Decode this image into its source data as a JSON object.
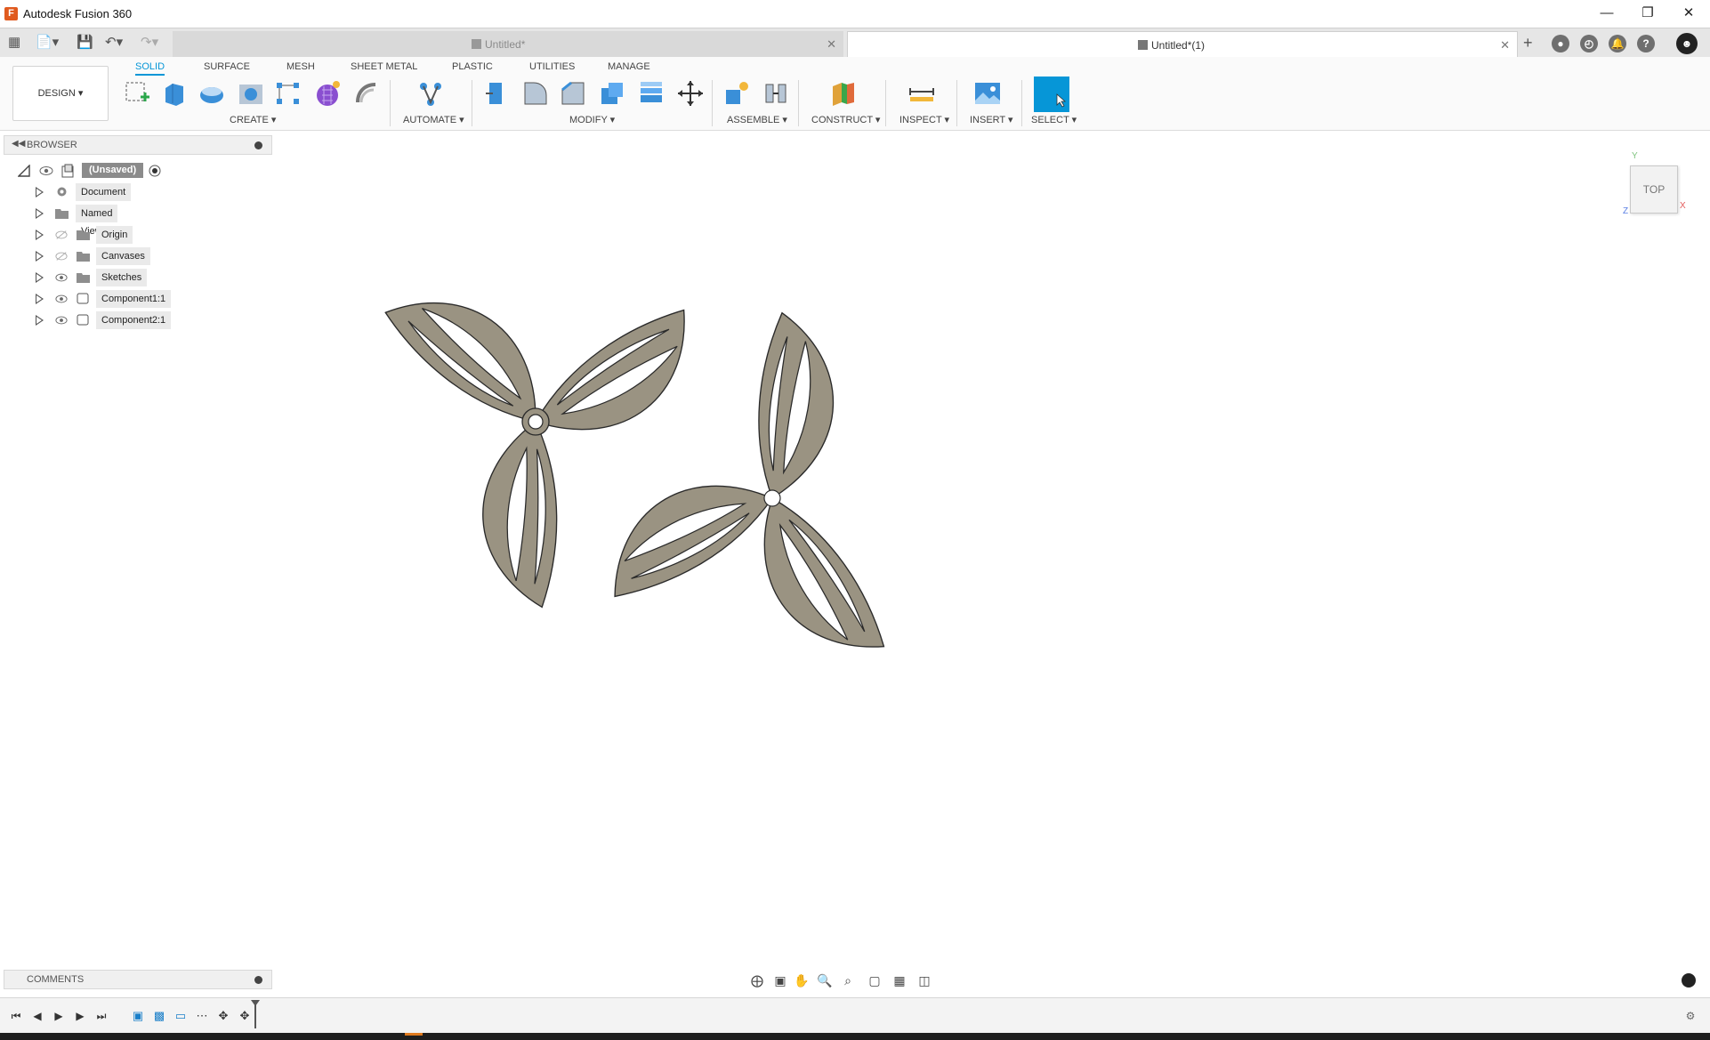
{
  "window": {
    "title": "Autodesk Fusion 360"
  },
  "tabs": {
    "inactive": "Untitled*",
    "active": "Untitled*(1)"
  },
  "toolbar": {
    "workspace": "DESIGN",
    "mode_tabs": [
      "SOLID",
      "SURFACE",
      "MESH",
      "SHEET METAL",
      "PLASTIC",
      "UTILITIES",
      "MANAGE"
    ],
    "groups": {
      "create": "CREATE",
      "automate": "AUTOMATE",
      "modify": "MODIFY",
      "assemble": "ASSEMBLE",
      "construct": "CONSTRUCT",
      "inspect": "INSPECT",
      "insert": "INSERT",
      "select": "SELECT"
    }
  },
  "browser": {
    "title": "BROWSER",
    "root": "(Unsaved)",
    "items": [
      {
        "label": "Document Settings",
        "icon": "gear-icon"
      },
      {
        "label": "Named Views",
        "icon": "folder-icon"
      },
      {
        "label": "Origin",
        "icon": "folder-icon"
      },
      {
        "label": "Canvases",
        "icon": "folder-icon"
      },
      {
        "label": "Sketches",
        "icon": "folder-icon"
      },
      {
        "label": "Component1:1",
        "icon": "component-icon"
      },
      {
        "label": "Component2:1",
        "icon": "component-icon"
      }
    ]
  },
  "viewcube": {
    "face": "TOP",
    "axes": {
      "x": "X",
      "y": "Y",
      "z": "Z"
    }
  },
  "comments": {
    "title": "COMMENTS"
  },
  "colors": {
    "accent": "#0696d7",
    "part_fill": "#9a9382",
    "part_stroke": "#2a2a2a"
  }
}
